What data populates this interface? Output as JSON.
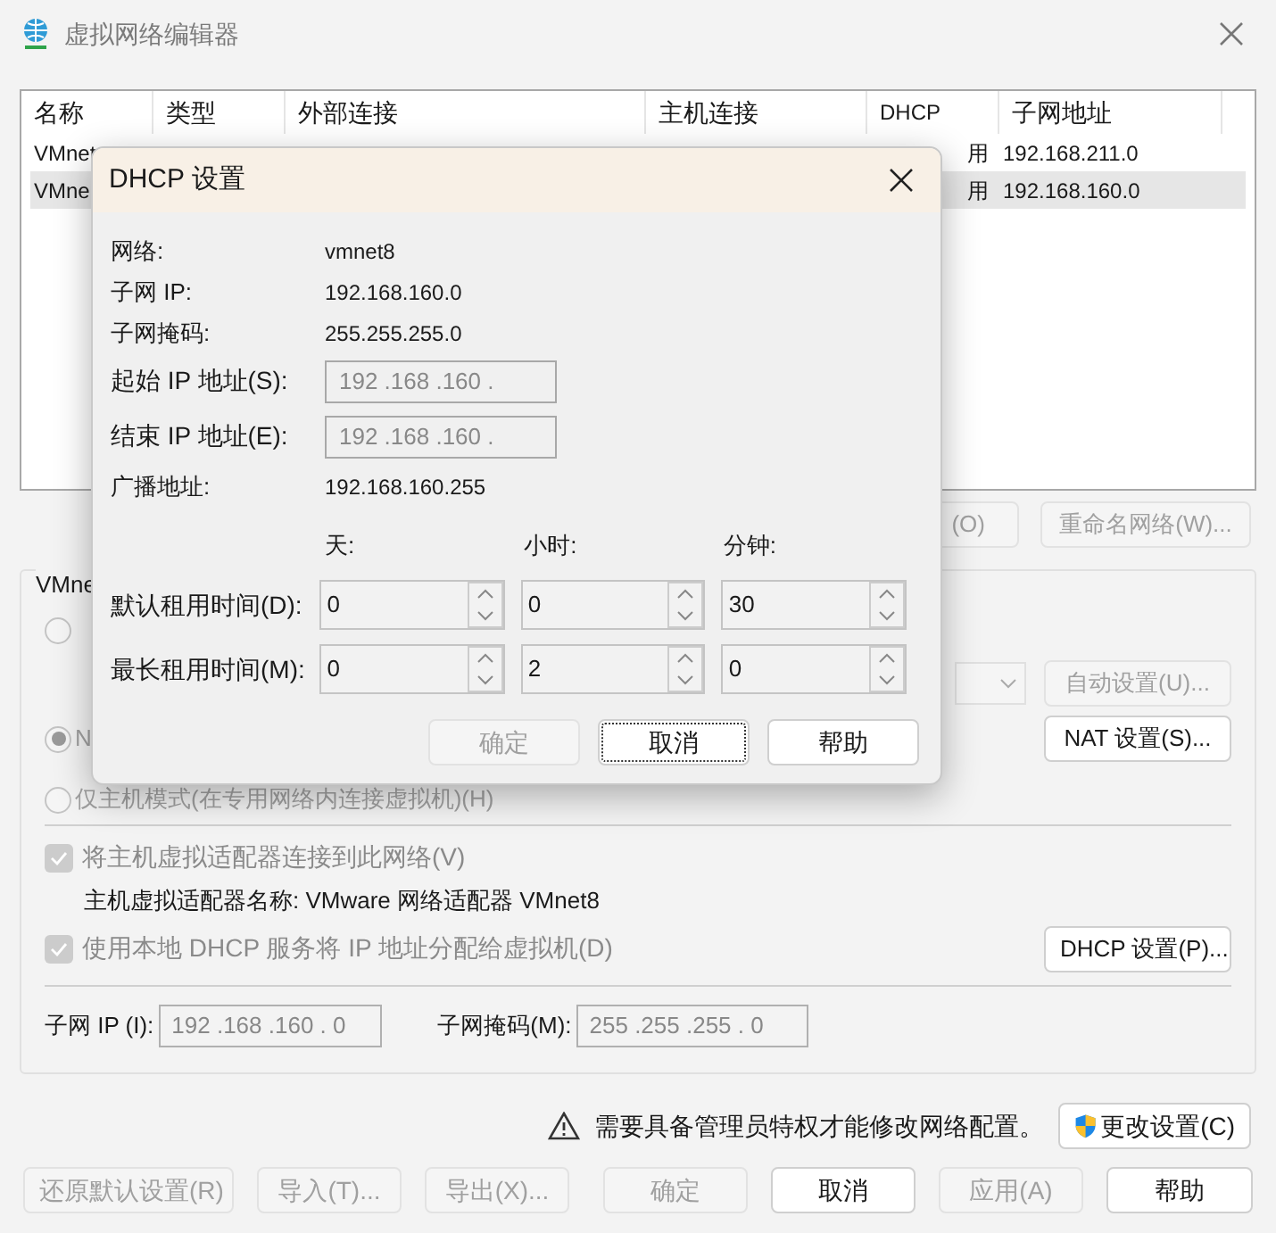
{
  "window": {
    "title": "虚拟网络编辑器"
  },
  "network_table": {
    "columns": [
      "名称",
      "类型",
      "外部连接",
      "主机连接",
      "DHCP",
      "子网地址"
    ],
    "rows": [
      {
        "name": "VMnet",
        "dhcp": "用",
        "subnet": "192.168.211.0",
        "selected": false
      },
      {
        "name": "VMne",
        "dhcp": "用",
        "subnet": "192.168.160.0",
        "selected": true
      }
    ]
  },
  "table_buttons": [
    {
      "label": "(O)",
      "disabled": true
    },
    {
      "label": "重命名网络(W)...",
      "disabled": true
    }
  ],
  "network_info": {
    "group_label": "VMne",
    "modes": [
      {
        "selected": false,
        "disabled": true
      },
      {
        "label": "N",
        "selected": true,
        "disabled": true
      },
      {
        "label": "仅主机模式(在专用网络内连接虚拟机)(H)",
        "selected": false,
        "disabled": true
      }
    ],
    "auto_button": {
      "label": "自动设置(U)...",
      "disabled": true
    },
    "nat_button": {
      "label": "NAT 设置(S)...",
      "disabled": false
    },
    "connect_adapter": {
      "label": "将主机虚拟适配器连接到此网络(V)",
      "checked": true,
      "disabled": true
    },
    "adapter_name": "主机虚拟适配器名称: VMware 网络适配器 VMnet8",
    "use_dhcp": {
      "label": "使用本地 DHCP 服务将 IP 地址分配给虚拟机(D)",
      "checked": true,
      "disabled": true
    },
    "dhcp_button": {
      "label": "DHCP 设置(P)...",
      "disabled": false
    },
    "subnet_ip": {
      "label": "子网 IP (I):",
      "value": "192 .168 .160 . 0"
    },
    "subnet_mask": {
      "label": "子网掩码(M):",
      "value": "255 .255 .255 . 0"
    }
  },
  "admin_notice": "需要具备管理员特权才能修改网络配置。",
  "change_button": {
    "label": "更改设置(C)",
    "disabled": false
  },
  "footer_buttons": [
    {
      "label": "还原默认设置(R)",
      "disabled": true
    },
    {
      "label": "导入(T)...",
      "disabled": true
    },
    {
      "label": "导出(X)...",
      "disabled": true
    },
    {
      "label": "确定",
      "disabled": true
    },
    {
      "label": "取消",
      "disabled": false
    },
    {
      "label": "应用(A)",
      "disabled": true
    },
    {
      "label": "帮助",
      "disabled": false
    }
  ],
  "dhcp_dialog": {
    "title": "DHCP 设置",
    "info": [
      {
        "label": "网络:",
        "value": "vmnet8"
      },
      {
        "label": "子网 IP:",
        "value": "192.168.160.0"
      },
      {
        "label": "子网掩码:",
        "value": "255.255.255.0"
      }
    ],
    "start_ip": {
      "label": "起始 IP 地址(S):",
      "value": "192 .168 .160 ."
    },
    "end_ip": {
      "label": "结束 IP 地址(E):",
      "value": "192 .168 .160 ."
    },
    "broadcast": {
      "label": "广播地址:",
      "value": "192.168.160.255"
    },
    "lease_columns": [
      "天:",
      "小时:",
      "分钟:"
    ],
    "leases": [
      {
        "label": "默认租用时间(D):",
        "values": [
          "0",
          "0",
          "30"
        ]
      },
      {
        "label": "最长租用时间(M):",
        "values": [
          "0",
          "2",
          "0"
        ]
      }
    ],
    "buttons": [
      {
        "label": "确定",
        "disabled": true,
        "focused": false
      },
      {
        "label": "取消",
        "disabled": false,
        "focused": true
      },
      {
        "label": "帮助",
        "disabled": false,
        "focused": false
      }
    ]
  }
}
